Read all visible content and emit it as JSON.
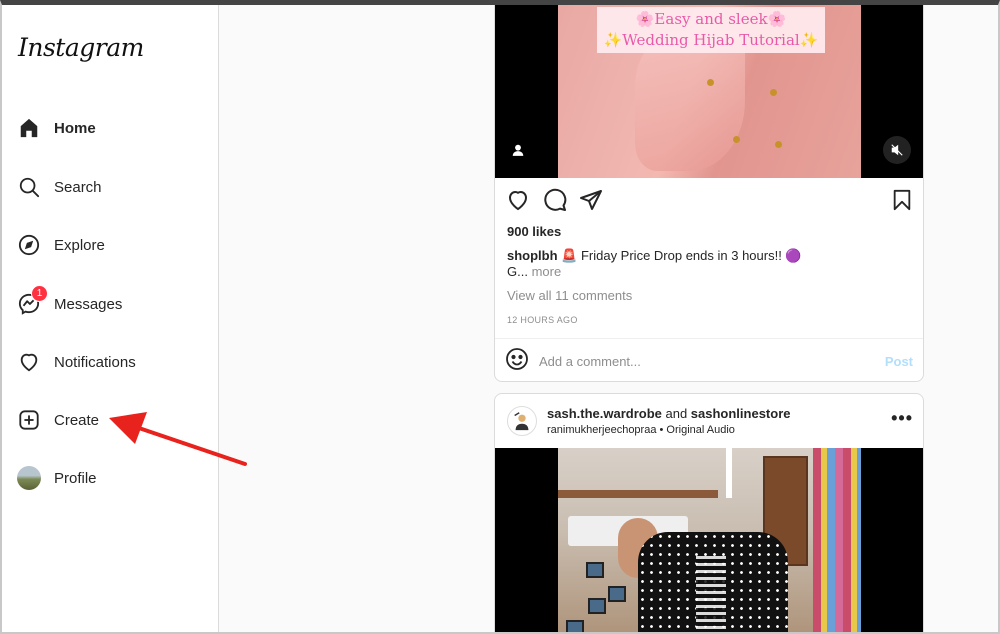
{
  "sidebar": {
    "logo": "Instagram",
    "items": [
      {
        "label": "Home",
        "icon": "home-icon",
        "active": true
      },
      {
        "label": "Search",
        "icon": "search-icon"
      },
      {
        "label": "Explore",
        "icon": "compass-icon"
      },
      {
        "label": "Messages",
        "icon": "messenger-icon",
        "badge": "1"
      },
      {
        "label": "Notifications",
        "icon": "heart-icon"
      },
      {
        "label": "Create",
        "icon": "plus-square-icon"
      },
      {
        "label": "Profile",
        "icon": "profile-avatar"
      }
    ]
  },
  "annotation": {
    "type": "arrow",
    "color": "#e8221c",
    "points_to": "Create"
  },
  "post1": {
    "overlay_line1": "🌸Easy and sleek🌸",
    "overlay_line2": "✨Wedding Hijab Tutorial✨",
    "likes": "900 likes",
    "username": "shoplbh",
    "caption_text": " 🚨 Friday Price Drop ends in 3 hours!! 🟣",
    "caption_cont": "G...",
    "more": " more",
    "view_comments": "View all 11 comments",
    "time": "12 HOURS AGO",
    "comment_placeholder": "Add a comment...",
    "post_label": "Post"
  },
  "post2": {
    "user1": "sash.the.wardrobe",
    "and": " and ",
    "user2": "sashonlinestore",
    "audio": "ranimukherjeechopraa • Original Audio",
    "more_icon": "•••"
  },
  "colors": {
    "accent": "#0095f6",
    "badge": "#ff3040",
    "arrow": "#e8221c"
  }
}
